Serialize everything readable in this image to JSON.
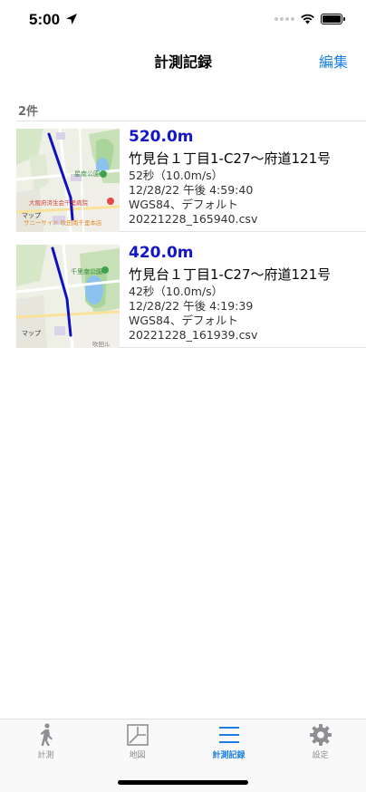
{
  "status_bar": {
    "time": "5:00"
  },
  "nav": {
    "title": "計測記録",
    "edit_label": "編集"
  },
  "section": {
    "count_label": "2件"
  },
  "records": [
    {
      "distance": "520.0m",
      "route": "竹見台１丁目1-C27〜府道121号",
      "duration": "52秒（10.0m/s）",
      "datetime": "12/28/22 午後 4:59:40",
      "datum": "WGS84、デフォルト",
      "filename": "20221228_165940.csv",
      "map": {
        "park_label": "星南公園",
        "hospital_label": "大阪府済生会千里病院",
        "store_label": "サニーサイド 吹田南千里本店",
        "maps_label": "マップ"
      }
    },
    {
      "distance": "420.0m",
      "route": "竹見台１丁目1-C27〜府道121号",
      "duration": "42秒（10.0m/s）",
      "datetime": "12/28/22 午後 4:19:39",
      "datum": "WGS84、デフォルト",
      "filename": "20221228_161939.csv",
      "map": {
        "park_label": "千里南公園",
        "maps_label": "マップ",
        "legal_label": "吹田ル"
      }
    }
  ],
  "tabs": [
    {
      "label": "計測",
      "icon": "walking-person-icon",
      "active": false
    },
    {
      "label": "地図",
      "icon": "map-icon",
      "active": false
    },
    {
      "label": "計測記録",
      "icon": "list-icon",
      "active": true
    },
    {
      "label": "設定",
      "icon": "gear-icon",
      "active": false
    }
  ],
  "colors": {
    "accent": "#1a7fe0",
    "distance": "#1414c8",
    "route_line": "#1010c0"
  }
}
